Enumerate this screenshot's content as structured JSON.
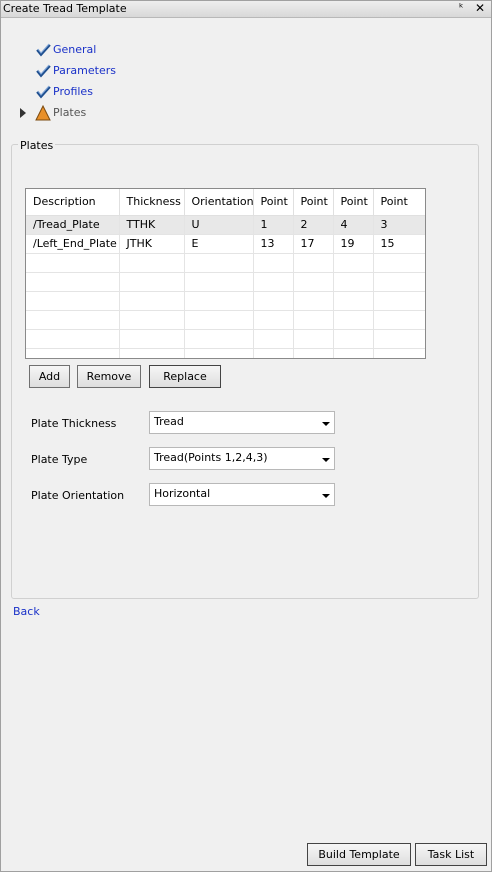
{
  "window": {
    "title": "Create Tread Template"
  },
  "steps": [
    {
      "label": "General",
      "state": "done"
    },
    {
      "label": "Parameters",
      "state": "done"
    },
    {
      "label": "Profiles",
      "state": "done"
    },
    {
      "label": "Plates",
      "state": "warning"
    }
  ],
  "plates_group": {
    "title": "Plates"
  },
  "table": {
    "columns": [
      "Description",
      "Thickness",
      "Orientation",
      "Point",
      "Point",
      "Point",
      "Point"
    ],
    "rows": [
      [
        "/Tread_Plate",
        "TTHK",
        "U",
        "1",
        "2",
        "4",
        "3"
      ],
      [
        "/Left_End_Plate",
        "JTHK",
        "E",
        "13",
        "17",
        "19",
        "15"
      ]
    ]
  },
  "buttons": {
    "add": "Add",
    "remove": "Remove",
    "replace": "Replace",
    "build": "Build Template",
    "tasklist": "Task List"
  },
  "fields": {
    "thickness": {
      "label": "Plate Thickness",
      "value": "Tread"
    },
    "type": {
      "label": "Plate Type",
      "value": "Tread(Points 1,2,4,3)"
    },
    "orientation": {
      "label": "Plate Orientation",
      "value": "Horizontal"
    }
  },
  "links": {
    "back": "Back"
  },
  "colors": {
    "link": "#1a31c8",
    "check": "#1f4f8f",
    "warning": "#e8902a"
  },
  "icons": {
    "done": "checkmark-icon",
    "warning": "warning-icon",
    "current": "triangle-right-icon"
  }
}
